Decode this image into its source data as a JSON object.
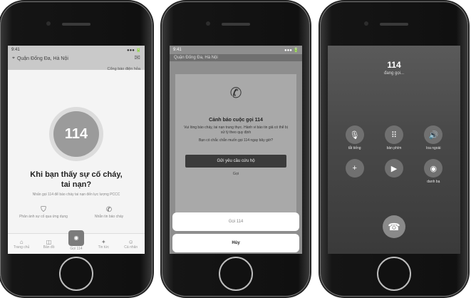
{
  "screen1": {
    "status_time": "9:41",
    "status_right": "●●● 🔋",
    "location": "Quận Đống Đa, Hà Nội",
    "report_link": "Cổng báo điện hỏa",
    "circle_number": "114",
    "headline_line1": "Khi bạn thấy sự cố cháy,",
    "headline_line2": "tai nạn?",
    "description": "Nhấn gọi 114 để báo cháy tai nạn đến lực lượng PCCC",
    "action_left": "Phản ánh sự cố qua ứng dụng",
    "action_right": "Nhắn tin báo cháy",
    "tabs": [
      "Trang chủ",
      "Bản đồ",
      "Gọi 114",
      "Tin tức",
      "Cá nhân"
    ]
  },
  "screen2": {
    "url": "Quận Đống Đa, Hà Nội",
    "card_title": "Cảnh báo cuộc gọi 114",
    "card_text1": "Vui lòng báo cháy, tai nạn trung thực. Hành vi báo tin giả có thể bị xử lý theo quy định",
    "card_text2": "Bạn có chắc chắn muốn gọi 114 ngay bây giờ?",
    "card_button": "Gửi yêu cầu cứu hộ",
    "card_link": "Gọi",
    "sheet_call": "Gọi 114",
    "sheet_cancel": "Hủy"
  },
  "screen3": {
    "number": "114",
    "status": "đang gọi...",
    "keys": [
      {
        "icon": "🎙",
        "label": "tắt tiếng"
      },
      {
        "icon": "⠿",
        "label": "bàn phím"
      },
      {
        "icon": "🔊",
        "label": "loa ngoài"
      },
      {
        "icon": "+",
        "label": ""
      },
      {
        "icon": "▶",
        "label": ""
      },
      {
        "icon": "◉",
        "label": "danh bạ"
      }
    ],
    "end_icon": "☎"
  }
}
